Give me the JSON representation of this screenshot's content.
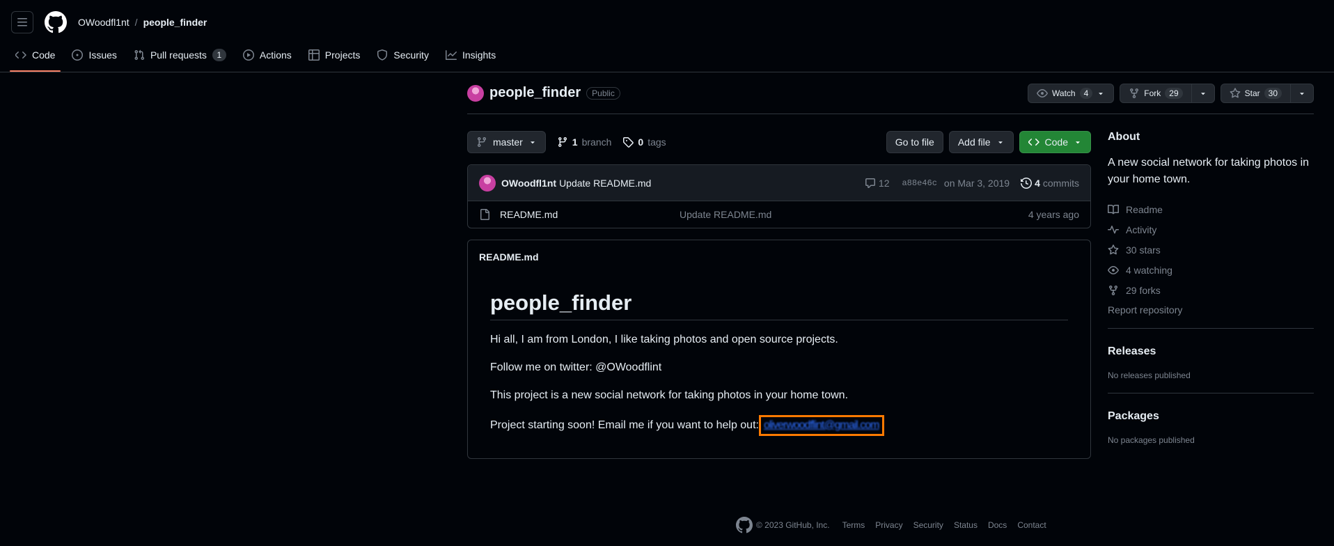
{
  "header": {
    "owner": "OWoodfl1nt",
    "separator": "/",
    "repo": "people_finder",
    "tabs": [
      {
        "label": "Code",
        "active": true
      },
      {
        "label": "Issues"
      },
      {
        "label": "Pull requests",
        "count": "1"
      },
      {
        "label": "Actions"
      },
      {
        "label": "Projects"
      },
      {
        "label": "Security"
      },
      {
        "label": "Insights"
      }
    ]
  },
  "repo": {
    "name": "people_finder",
    "visibility": "Public",
    "watch": {
      "label": "Watch",
      "count": "4"
    },
    "fork": {
      "label": "Fork",
      "count": "29"
    },
    "star": {
      "label": "Star",
      "count": "30"
    }
  },
  "toolbar": {
    "branch_select": "master",
    "branches_count": "1",
    "branches_label": "branch",
    "tags_count": "0",
    "tags_label": "tags",
    "go_to_file": "Go to file",
    "add_file": "Add file",
    "code": "Code"
  },
  "commit": {
    "author": "OWoodfl1nt",
    "message": "Update README.md",
    "comments": "12",
    "sha": "a88e46c",
    "date": "on Mar 3, 2019",
    "commits_count": "4",
    "commits_label": "commits"
  },
  "files": [
    {
      "name": "README.md",
      "message": "Update README.md",
      "age": "4 years ago"
    }
  ],
  "readme": {
    "header": "README.md",
    "title": "people_finder",
    "p1": "Hi all, I am from London, I like taking photos and open source projects.",
    "p2": "Follow me on twitter: @OWoodflint",
    "p3": "This project is a new social network for taking photos in your home town.",
    "p4": "Project starting soon! Email me if you want to help out:",
    "email": "oliverwoodflint@gmail.com"
  },
  "about": {
    "title": "About",
    "description": "A new social network for taking photos in your home town.",
    "readme": "Readme",
    "activity": "Activity",
    "stars": "30 stars",
    "watching": "4 watching",
    "forks": "29 forks",
    "report": "Report repository"
  },
  "releases": {
    "title": "Releases",
    "note": "No releases published"
  },
  "packages": {
    "title": "Packages",
    "note": "No packages published"
  },
  "footer": {
    "copyright": "© 2023 GitHub, Inc.",
    "links": [
      "Terms",
      "Privacy",
      "Security",
      "Status",
      "Docs",
      "Contact"
    ]
  },
  "colors": {
    "accent": "#f78166",
    "green": "#238636",
    "highlight": "#ff7a00"
  }
}
